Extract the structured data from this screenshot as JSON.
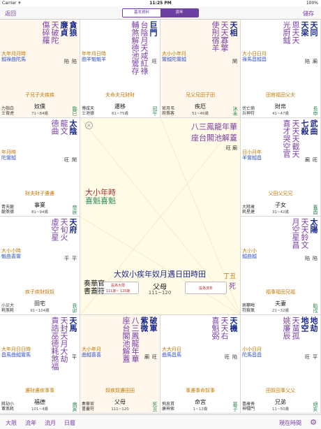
{
  "status": {
    "carrier": "Carrier ✈",
    "time": "11:25 PM",
    "battery": "100%"
  },
  "nav": {
    "back": "返回",
    "save": "儲存",
    "seg_basic": "基本資料",
    "seg_chart": "流年"
  },
  "cells": [
    {
      "stars_main": [
        "貪狼",
        "廉貞"
      ],
      "stars_minor": [
        "天破陀",
        "傷碎羅"
      ],
      "bright": [
        "陷",
        "陷"
      ],
      "ystars": "大年月月時",
      "ystars2": "鉞祿曲陀馬",
      "sihua": "子兄子夫疾疾",
      "left": "力指白\n士背虎",
      "name": "奴僕",
      "range": "71~84歲",
      "gz": "臨巳",
      "tint": true
    },
    {
      "stars_main": [
        "巨門"
      ],
      "stars_minor": [
        "台陰月天咸紅祿",
        "輔煞解德池鸞存"
      ],
      "bright": [
        "旺"
      ],
      "ystars": "年年月日時",
      "ystars2": "曲羊魁魁羊",
      "sihua": "夫命夫兄財財",
      "left": "博咸天\n士池德",
      "name": "遷移",
      "range": "61~75歲",
      "gz": "冠午",
      "tint": false
    },
    {
      "stars_main": [
        "天相"
      ],
      "stars_minor": [
        "天天寡擎",
        "使刑宿羊"
      ],
      "bright": [
        "閑"
      ],
      "ystars": "大小小年月",
      "ystars2": "鸞鉞陀鸞鉞",
      "sihua": "兄父兄田子田",
      "left": "官月弔\n府煞客",
      "name": "疾厄",
      "range": "51~46歲",
      "gz": "沐未",
      "tint": true
    },
    {
      "stars_main": [
        "天同",
        "天梁"
      ],
      "stars_minor": [
        "恩天天",
        "光廚鉞"
      ],
      "bright": [
        "廟",
        "陷"
      ],
      "ystars": "大小日日月",
      "ystars2": "祿馬昌鉞昌",
      "sihua": "田官福田父夫",
      "left": "伏亡病\n兵神符",
      "name": "財帛",
      "range": "41~47歲",
      "gz": "長申",
      "tint": false
    },
    {
      "stars_main": [
        "太陰"
      ],
      "stars_minor": [
        "龍文",
        "德曲"
      ],
      "bright": [
        "閑",
        "旺"
      ],
      "ystars": "年月時",
      "ystars2": "陀鸞鉞",
      "sihua": "財夫財子遷遷",
      "left": "青天龍\n龍煞德",
      "name": "事業",
      "range": "81~94歲",
      "gz": "帝辰",
      "tint": false
    },
    {
      "stars_main": [
        "武曲",
        "七殺"
      ],
      "stars_minor": [
        "天天天截天",
        "喜才哭空官"
      ],
      "bright": [
        "旺",
        "廟"
      ],
      "ystars": "日小月年",
      "ystars2": "羊鸞鉞昌",
      "sihua": "父田父兄兄",
      "left": "大將歲\n耗星建",
      "name": "子女",
      "range": "31~42歲",
      "gz": "養酉",
      "tint": false
    },
    {
      "stars_main": [
        "天府"
      ],
      "stars_minor": [
        "天旬火",
        "虛空星"
      ],
      "bright": [
        "平",
        "平"
      ],
      "ystars": "大小小時",
      "ystars2": "魁曲喜鸞",
      "sihua": "疾子疾財奴奴",
      "left": "小災大\n耗煞耗",
      "name": "田宅",
      "range": "91~104歲",
      "gz": "衰卯",
      "tint": false
    },
    {
      "stars_main": [
        "太陽"
      ],
      "stars_minor": [
        "天天鈴文",
        "月空星昌"
      ],
      "bright": [
        "陷",
        "陷"
      ],
      "ystars": "大小小",
      "ystars2": "鉞曲鉞",
      "sihua": "福事福田兄福",
      "left": "病攀晦\n符鞍氣",
      "name": "夫妻",
      "range": "21~32歲",
      "gz": "胎戌",
      "tint": false
    },
    {
      "stars_main": [
        "天馬"
      ],
      "stars_minor": [
        "天封天月大劫",
        "貴誥巫德耗煞福"
      ],
      "bright": [
        "平"
      ],
      "ystars": "大年月日日時",
      "ystars2": "昌馬曲鉞鸞馬",
      "sihua": "遷財遷疾事事",
      "left": "將劫小\n軍煞耗",
      "name": "福德",
      "range": "101~4歲",
      "gz": "病寅",
      "tint": false
    },
    {
      "stars_main": [
        "破軍",
        "紫微"
      ],
      "stars_minor": [
        "八三鳳龍年華",
        "座台閣池解蓋"
      ],
      "bright": [
        "旺",
        "廟"
      ],
      "ystars": "大小年月",
      "ystars2": "曲鉞喜喜",
      "sihua": "奴疾奴遷田田",
      "left": "奏華官\n書蓋符",
      "name": "父母",
      "range": "111~120",
      "gz": "死丑",
      "tint": true
    },
    {
      "stars_main": [
        "天機"
      ],
      "stars_minor": [
        "天天右",
        "喜魁弼"
      ],
      "bright": [
        "陷",
        "旺"
      ],
      "ystars": "大大月日",
      "ystars2": "曲馬昌馬",
      "sihua": "事遷事命奴事",
      "left": "飛息貫\n廉神索",
      "name": "命宮",
      "range": "1~12歲",
      "gz": "墓子",
      "tint": false
    },
    {
      "stars_main": [
        "地劫",
        "地空"
      ],
      "stars_minor": [
        "天蜚孤",
        "姚廉辰"
      ],
      "bright": [
        "平",
        "旺"
      ],
      "ystars": "小小日月",
      "ystars2": "陀馬昌昌",
      "sihua": "田奴田事父父",
      "left": "喜歲喪\n神驛門",
      "name": "兄弟",
      "range": "11~50歲",
      "gz": "絕亥",
      "tint": false
    }
  ],
  "center": {
    "stars": "大奴小疾年奴月遇日田時田",
    "stars_bright": [
      "破",
      "紫"
    ],
    "top_minor": "八三鳳龍年華",
    "top_minor2": "座台閣池解蓋",
    "bright_row": "旺 廟",
    "left_label": "奏華官\n書蓋符",
    "name": "父母",
    "range": "111~120",
    "gz": "丁丑",
    "gz2": "死",
    "mid_left": [
      "大小年時",
      "喜魁喜魁"
    ],
    "btn_left_1": "設為大限",
    "btn_left_2": "111歲~ 120歲",
    "btn_right": "設為流年"
  },
  "tabbar": {
    "t1": "大限",
    "t2": "流年",
    "t3": "流月",
    "t4": "日曆",
    "now": "現在時間"
  }
}
